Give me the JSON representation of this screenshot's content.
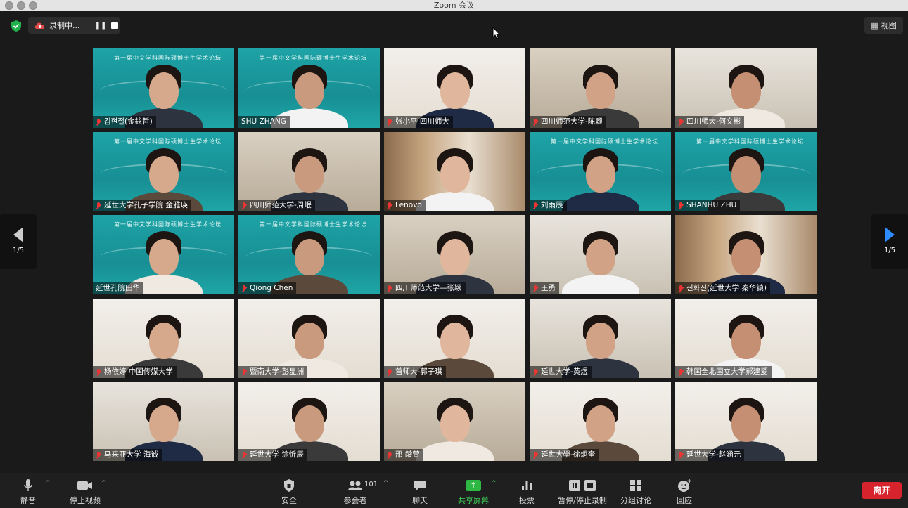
{
  "window": {
    "title": "Zoom 会议"
  },
  "recording": {
    "label": "录制中..."
  },
  "view_button": {
    "label": "视图"
  },
  "pagination": {
    "left": "1/5",
    "right": "1/5"
  },
  "participants": [
    {
      "name": "김현철(金鉉哲)",
      "muted": true,
      "bg": "teal",
      "banner": "第一届中文学科国际硕博士生学术论坛"
    },
    {
      "name": "SHU ZHANG",
      "muted": false,
      "bg": "teal",
      "banner": "第一届中文学科国际硕博士生学术论坛"
    },
    {
      "name": "张小平 四川师大",
      "muted": true,
      "bg": "white"
    },
    {
      "name": "四川师范大学-陈颖",
      "muted": true,
      "bg": "room"
    },
    {
      "name": "四川师大-何文彬",
      "muted": true,
      "bg": "room2"
    },
    {
      "name": "延世大学孔子学院 金雅瑛",
      "muted": true,
      "bg": "teal",
      "banner": "第一届中文学科国际硕博士生学术论坛"
    },
    {
      "name": "四川师范大学-周岷",
      "muted": true,
      "bg": "room"
    },
    {
      "name": "Lenovo",
      "muted": true,
      "bg": "shelf"
    },
    {
      "name": "刘雨辰",
      "muted": true,
      "bg": "teal",
      "banner": "第一届中文学科国际硕博士生学术论坛"
    },
    {
      "name": "SHANHU ZHU",
      "muted": true,
      "bg": "teal",
      "banner": "第一届中文学科国际硕博士生学术论坛"
    },
    {
      "name": "延世孔院田华",
      "muted": false,
      "bg": "teal",
      "active": true,
      "banner": "第一届中文学科国际硕博士生学术论坛"
    },
    {
      "name": "Qiong Chen",
      "muted": true,
      "bg": "teal",
      "banner": "第一届中文学科国际硕博士生学术论坛"
    },
    {
      "name": "四川师范大学—张颖",
      "muted": true,
      "bg": "room"
    },
    {
      "name": "王勇",
      "muted": true,
      "bg": "room2"
    },
    {
      "name": "진화진(延世大学 秦华镇)",
      "muted": true,
      "bg": "shelf"
    },
    {
      "name": "杨依婷 中国传媒大学",
      "muted": true,
      "bg": "white"
    },
    {
      "name": "暨南大学-彭显洲",
      "muted": true,
      "bg": "white"
    },
    {
      "name": "首师大-郭子琪",
      "muted": true,
      "bg": "white"
    },
    {
      "name": "延世大学-黄煜",
      "muted": true,
      "bg": "room2"
    },
    {
      "name": "韩国全北国立大学郝建爱",
      "muted": true,
      "bg": "white"
    },
    {
      "name": "马来亚大学 海诚",
      "muted": true,
      "bg": "room2"
    },
    {
      "name": "延世大学 涂忻辰",
      "muted": true,
      "bg": "white"
    },
    {
      "name": "邵 龄萱",
      "muted": true,
      "bg": "room"
    },
    {
      "name": "延世大學-徐炯奎",
      "muted": true,
      "bg": "white"
    },
    {
      "name": "延世大学-赵涵元",
      "muted": true,
      "bg": "white"
    }
  ],
  "toolbar": {
    "mute": "静音",
    "stop_video": "停止视频",
    "security": "安全",
    "participants": "参会者",
    "participants_count": "101",
    "chat": "聊天",
    "share": "共享屏幕",
    "poll": "投票",
    "record": "暂停/停止录制",
    "breakout": "分组讨论",
    "reactions": "回应",
    "leave": "离开"
  }
}
